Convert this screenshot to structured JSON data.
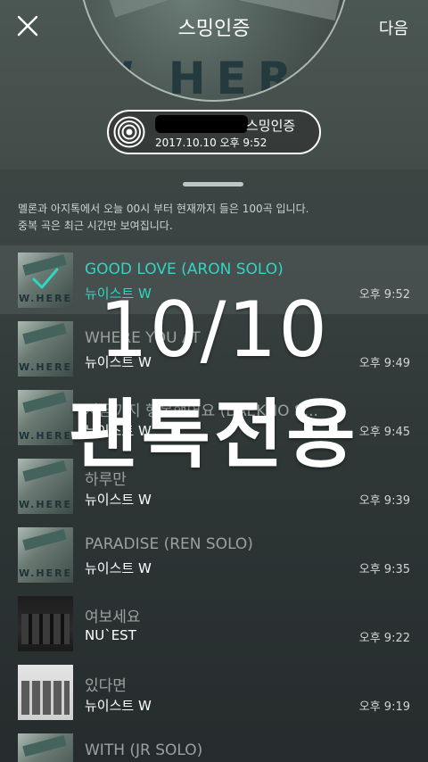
{
  "header": {
    "album_title": "스밍인증",
    "album_art_word": "W.HERE",
    "next_label": "다음"
  },
  "cert": {
    "label": "스밍인증",
    "datetime": "2017.10.10 오후 9:52"
  },
  "notice": {
    "line1": "멜론과 아지톡에서 오늘 00시 부터 현재까지 들은 100곡 입니다.",
    "line2": "중복 곡은 최근 시간만 보여집니다."
  },
  "songs": [
    {
      "title": "GOOD LOVE (ARON SOLO)",
      "artist": "뉴이스트 W",
      "time": "오후 9:52",
      "art": "where",
      "selected": true
    },
    {
      "title": "WHERE YOU AT",
      "artist": "뉴이스트 W",
      "time": "오후 9:49",
      "art": "where",
      "selected": false
    },
    {
      "title": "지금까지 행복했어요 (BAEKHO S...",
      "artist": "뉴이스트 W",
      "time": "오후 9:45",
      "art": "where",
      "selected": false
    },
    {
      "title": "하루만",
      "artist": "뉴이스트 W",
      "time": "오후 9:39",
      "art": "where",
      "selected": false
    },
    {
      "title": "PARADISE (REN SOLO)",
      "artist": "뉴이스트 W",
      "time": "오후 9:35",
      "art": "where",
      "selected": false
    },
    {
      "title": "여보세요",
      "artist": "NU`EST",
      "time": "오후 9:22",
      "art": "band",
      "selected": false
    },
    {
      "title": "있다면",
      "artist": "뉴이스트 W",
      "time": "오후 9:19",
      "art": "white",
      "selected": false
    },
    {
      "title": "WITH (JR SOLO)",
      "artist": "",
      "time": "",
      "art": "where",
      "selected": false
    }
  ],
  "overlay": {
    "line1": "10/10",
    "line2": "팬톡전용"
  },
  "colors": {
    "accent": "#2ed6c3",
    "background": "#3a4442"
  },
  "icons": {
    "close": "close-icon",
    "disc": "disc-icon",
    "check": "check-icon"
  }
}
